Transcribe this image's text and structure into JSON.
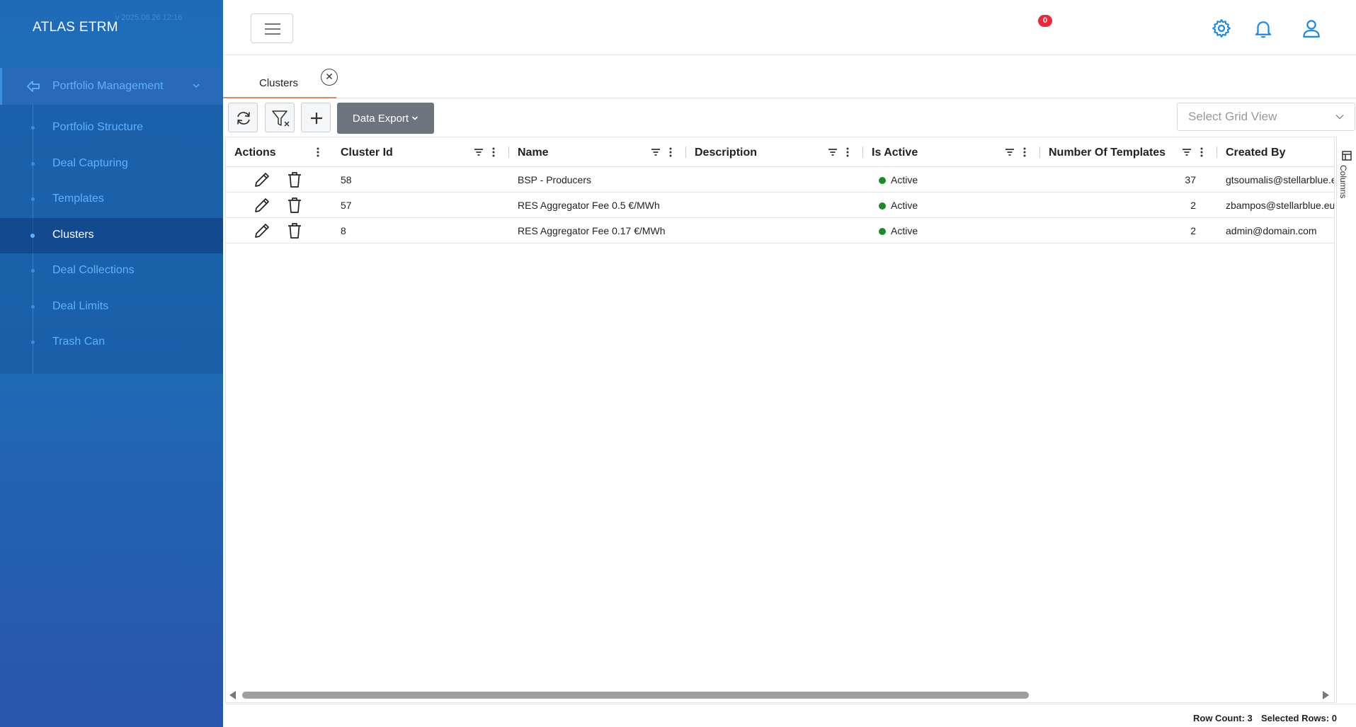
{
  "app": {
    "title": "ATLAS ETRM",
    "version": "v 2025.08.26 12:16"
  },
  "sidebar": {
    "parent": {
      "label": "Portfolio Management",
      "icon": "arrow-left-icon"
    },
    "items": [
      {
        "label": "Portfolio Structure"
      },
      {
        "label": "Deal Capturing"
      },
      {
        "label": "Templates"
      },
      {
        "label": "Clusters",
        "active": true
      },
      {
        "label": "Deal Collections"
      },
      {
        "label": "Deal Limits"
      },
      {
        "label": "Trash Can"
      }
    ]
  },
  "topbar": {
    "icons": [
      "menu-icon",
      "gear-icon",
      "bell-icon",
      "user-icon"
    ],
    "notification_count": "0",
    "accent": "#1e88e5"
  },
  "tabs": [
    {
      "label": "Clusters",
      "closable": true
    }
  ],
  "toolbar": {
    "refresh_icon": "refresh-icon",
    "clear_filter_icon": "clear-filter-icon",
    "add_icon": "plus-icon",
    "export_label": "Data Export",
    "grid_view_placeholder": "Select Grid View"
  },
  "grid": {
    "columns": [
      {
        "label": "Actions"
      },
      {
        "label": "Cluster Id"
      },
      {
        "label": "Name"
      },
      {
        "label": "Description"
      },
      {
        "label": "Is Active"
      },
      {
        "label": "Number Of Templates"
      },
      {
        "label": "Created By"
      }
    ],
    "rows": [
      {
        "id": "58",
        "name": "BSP - Producers",
        "description": "",
        "active": "Active",
        "templates": "37",
        "created_by": "gtsoumalis@stellarblue.eu"
      },
      {
        "id": "57",
        "name": "RES Aggregator Fee 0.5 €/MWh",
        "description": "",
        "active": "Active",
        "templates": "2",
        "created_by": "zbampos@stellarblue.eu"
      },
      {
        "id": "8",
        "name": "RES Aggregator Fee 0.17 €/MWh",
        "description": "",
        "active": "Active",
        "templates": "2",
        "created_by": "admin@domain.com"
      }
    ],
    "side_panel_label": "Columns",
    "status_color": "#1a8a2b"
  },
  "footer": {
    "row_count": "Row Count: 3",
    "selected_rows": "Selected Rows: 0"
  }
}
